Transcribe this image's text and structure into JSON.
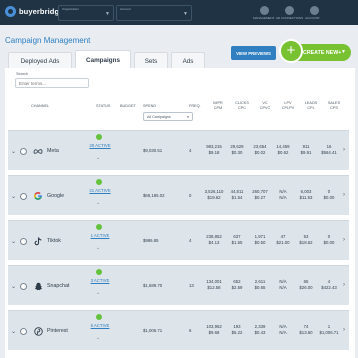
{
  "app": {
    "logo_text": "buyerbridge",
    "org_label": "Organization",
    "account_label": "Account",
    "nav_icons": [
      {
        "name": "notifications-icon",
        "caption": "MANAGEMENT"
      },
      {
        "name": "ad-connections-icon",
        "caption": "AD CONNECTIONS"
      },
      {
        "name": "user-icon",
        "caption": "ACCOUNT"
      }
    ]
  },
  "page": {
    "title": "Campaign Management"
  },
  "tabs": [
    {
      "label": "Deployed Ads",
      "active": false
    },
    {
      "label": "Campaigns",
      "active": true
    },
    {
      "label": "Sets",
      "active": false
    },
    {
      "label": "Ads",
      "active": false
    }
  ],
  "actions": {
    "preview_label": "VIEW PREVIEWS",
    "create_label": "CREATE NEW+"
  },
  "search": {
    "label": "Search",
    "placeholder": "Enter terms..."
  },
  "table": {
    "headers": {
      "channel": "CHANNEL",
      "status": "STATUS",
      "budget": "BUDGET",
      "spend": "SPEND",
      "freq": "FREQ.",
      "impr": "IMPR",
      "impr_sub": "CPM",
      "clicks": "CLICKS",
      "clicks_sub": "CPC",
      "vc": "VC",
      "vc_sub": "CPVC",
      "lpv": "LPV",
      "lpv_sub": "CPLPV",
      "leads": "LEADS",
      "leads_sub": "CPL",
      "sales": "SALES",
      "sales_sub": "CPS"
    },
    "campaign_filter": "All Campaigns",
    "rows": [
      {
        "platform": "Meta",
        "icon": "meta-icon",
        "status": "28 ACTIVE",
        "spend": "$9,030.51",
        "freq": "4",
        "impr": "983,215",
        "cpm": "$9.18",
        "clicks": "29,628",
        "cpc": "$0.30",
        "vc": "23,654",
        "cpvc": "$0.02",
        "lpv": "14,459",
        "cplpv": "$0.62",
        "leads": "911",
        "cpl": "$9.91",
        "sales": "16",
        "cps": "$564.41"
      },
      {
        "platform": "Google",
        "icon": "google-icon",
        "status": "21 ACTIVE",
        "spend": "$69,185.02",
        "freq": "0",
        "impr": "3,526,110",
        "cpm": "$19.62",
        "clicks": "44,811",
        "cpc": "$1.54",
        "vc": "260,707",
        "cpvc": "$0.27",
        "lpv": "N/A",
        "cplpv": "N/A",
        "leads": "6,003",
        "cpl": "$11.53",
        "sales": "0",
        "cps": "$0.00"
      },
      {
        "platform": "Tiktok",
        "icon": "tiktok-icon",
        "status": "1 ACTIVE",
        "spend": "$986.85",
        "freq": "4",
        "impr": "238,852",
        "cpm": "$4.13",
        "clicks": "637",
        "cpc": "$1.55",
        "vc": "1,971",
        "cpvc": "$0.50",
        "lpv": "47",
        "cplpv": "$21.00",
        "leads": "53",
        "cpl": "$18.62",
        "sales": "0",
        "cps": "$0.00"
      },
      {
        "platform": "Snapchat",
        "icon": "snapchat-icon",
        "status": "3 ACTIVE",
        "spend": "$1,689.70",
        "freq": "13",
        "impr": "134,001",
        "cpm": "$12.58",
        "clicks": "652",
        "cpc": "$2.59",
        "vc": "2,611",
        "cpvc": "$0.65",
        "lpv": "N/A",
        "cplpv": "N/A",
        "leads": "65",
        "cpl": "$26.00",
        "sales": "4",
        "cps": "$422.43"
      },
      {
        "platform": "Pinterest",
        "icon": "pinterest-icon",
        "status": "6 ACTIVE",
        "spend": "$1,006.71",
        "freq": "6",
        "impr": "103,962",
        "cpm": "$9.68",
        "clicks": "193",
        "cpc": "$5.22",
        "vc": "2,339",
        "cpvc": "$0.43",
        "lpv": "N/A",
        "cplpv": "N/A",
        "leads": "74",
        "cpl": "$13.60",
        "sales": "1",
        "cps": "$1,006.71"
      }
    ]
  },
  "colors": {
    "brand_blue": "#2f7fc1",
    "accent_green": "#78c232",
    "status_green": "#64c23c",
    "topbar": "#1f3344"
  }
}
